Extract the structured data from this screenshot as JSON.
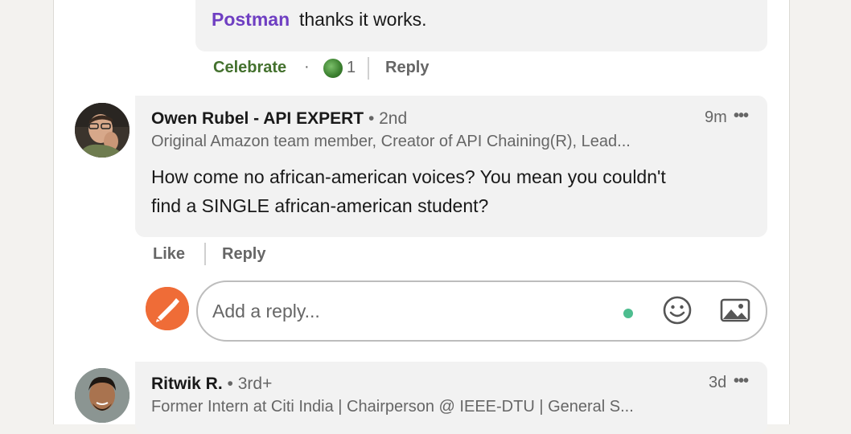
{
  "comment_top": {
    "mention": "Postman",
    "text": "thanks it works.",
    "reaction_label": "Celebrate",
    "separator": "·",
    "reaction_count": "1",
    "reply_label": "Reply"
  },
  "comment_owen": {
    "name": "Owen Rubel - API EXPERT",
    "degree": "• 2nd",
    "headline": "Original Amazon team member, Creator of API Chaining(R), Lead...",
    "time": "9m",
    "more": "•••",
    "body_line1": "How come no african-american voices? You mean you couldn't",
    "body_line2": "find a SINGLE african-american student?",
    "like_label": "Like",
    "reply_label": "Reply"
  },
  "reply_box": {
    "placeholder": "Add a reply..."
  },
  "comment_ritwik": {
    "name": "Ritwik R.",
    "degree": "• 3rd+",
    "headline": "Former Intern at Citi India | Chairperson @ IEEE-DTU | General S...",
    "time": "3d",
    "more": "•••"
  },
  "colors": {
    "mention": "#6f3fc2",
    "celebrate": "#44712e",
    "postman_orange": "#ef6c37",
    "online_dot": "#4dbd8f"
  },
  "icons": {
    "celebrate": "celebrate-reaction-icon",
    "emoji": "emoji-icon",
    "image": "image-icon",
    "more": "more-options-icon"
  }
}
